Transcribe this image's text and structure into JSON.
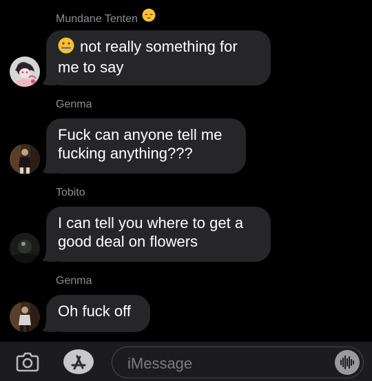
{
  "thread": {
    "messages": [
      {
        "sender": "Mundane Tenten",
        "sender_emoji_icon": "pensive-face-emoji",
        "text": "not really something for me to say",
        "lead_emoji_icon": "zipper-mouth-face-emoji",
        "avatar_icon": "anime-character-avatar"
      },
      {
        "sender": "Genma",
        "text": "Fuck can anyone tell me fucking anything???",
        "avatar_icon": "person-photo-avatar"
      },
      {
        "sender": "Tobito",
        "text": "I can tell you where to get a good deal on flowers",
        "avatar_icon": "dark-photo-avatar"
      },
      {
        "sender": "Genma",
        "text": "Oh fuck off",
        "avatar_icon": "person-photo-avatar"
      }
    ]
  },
  "composer": {
    "placeholder": "iMessage",
    "camera_icon": "camera-icon",
    "apps_icon": "app-store-icon",
    "audio_icon": "audio-waveform-icon"
  },
  "colors": {
    "background": "#000000",
    "bubble": "#262628",
    "sender_name": "#8e8e93",
    "composer_bar": "#1c1c1e",
    "placeholder": "#7c7c80"
  }
}
